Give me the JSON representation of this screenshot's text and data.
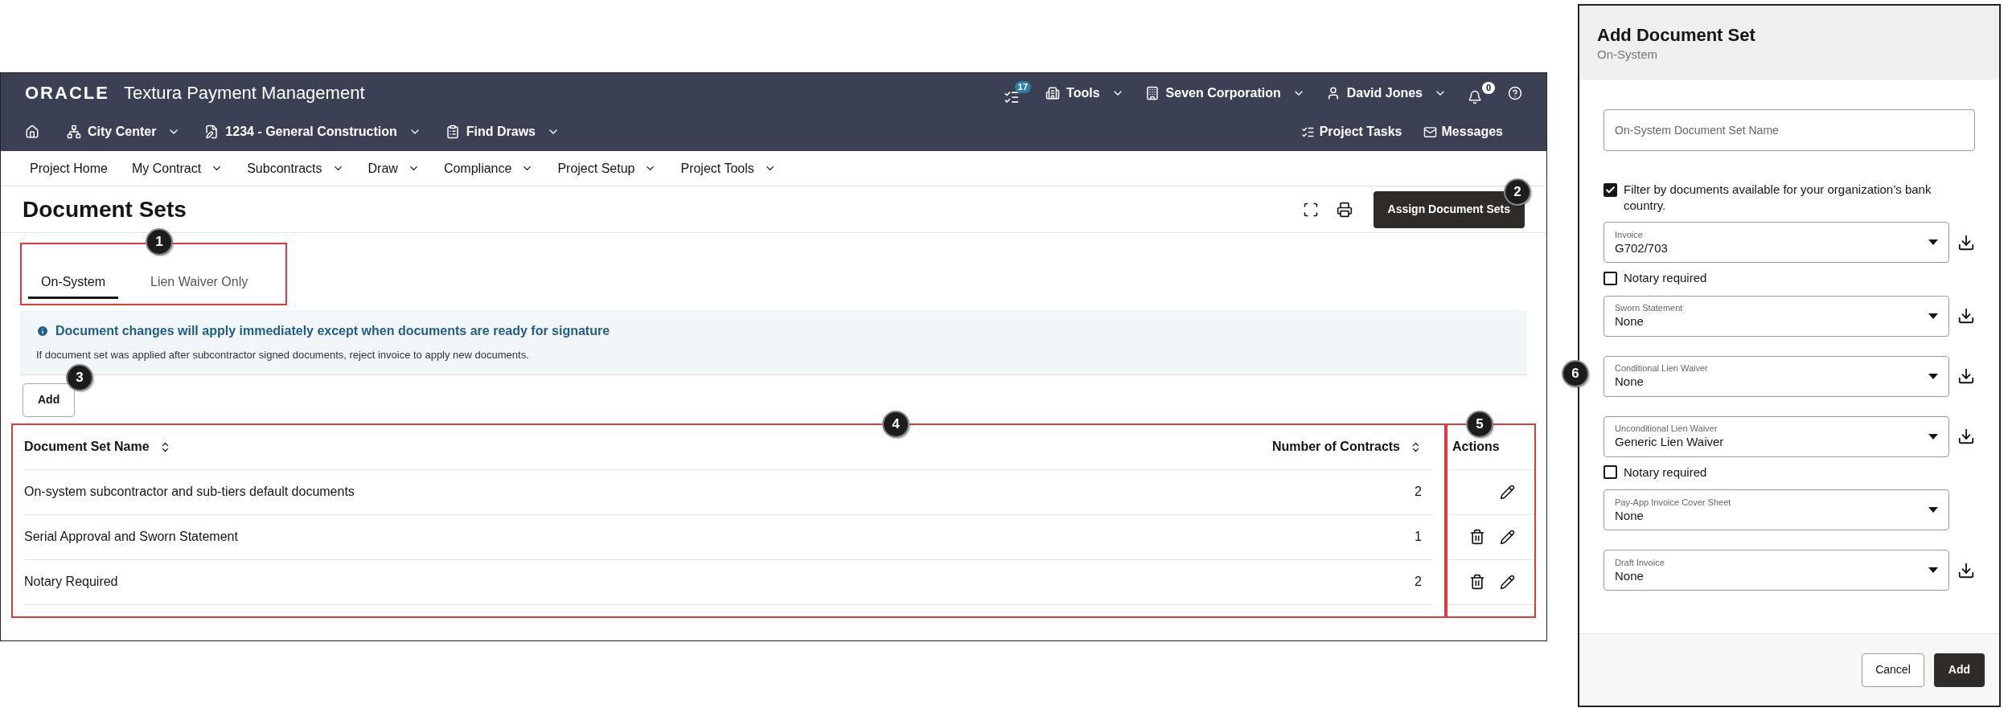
{
  "header": {
    "logo": "ORACLE",
    "product": "Textura Payment Management",
    "tasks_badge": "17",
    "menus": [
      {
        "label": "Tools"
      },
      {
        "label": "Seven Corporation"
      },
      {
        "label": "David Jones"
      }
    ],
    "notifications_badge": "0"
  },
  "context_bar": {
    "items": [
      {
        "label": "City Center"
      },
      {
        "label": "1234 - General Construction"
      },
      {
        "label": "Find Draws"
      }
    ],
    "links": [
      {
        "label": "Project Tasks"
      },
      {
        "label": "Messages"
      }
    ]
  },
  "nav": [
    {
      "label": "Project Home",
      "has_menu": false
    },
    {
      "label": "My Contract",
      "has_menu": true
    },
    {
      "label": "Subcontracts",
      "has_menu": true
    },
    {
      "label": "Draw",
      "has_menu": true
    },
    {
      "label": "Compliance",
      "has_menu": true
    },
    {
      "label": "Project Setup",
      "has_menu": true
    },
    {
      "label": "Project Tools",
      "has_menu": true
    }
  ],
  "page": {
    "title": "Document Sets",
    "primary_button": "Assign Document Sets",
    "primary_callout": "2"
  },
  "tabs": {
    "highlighted": true,
    "callout": "1",
    "items": [
      {
        "label": "On-System",
        "selected": true
      },
      {
        "label": "Lien Waiver Only",
        "selected": false
      }
    ]
  },
  "banner": {
    "title": "Document changes will apply immediately except when documents are ready for signature",
    "text": "If document set was applied after subcontractor signed documents, reject invoice to apply new documents."
  },
  "add_button": {
    "label": "Add",
    "callout": "3"
  },
  "table": {
    "highlighted": true,
    "callout": "4",
    "columns": [
      {
        "label": "Document Set Name",
        "sortable": true
      },
      {
        "label": "Number of Contracts",
        "sortable": true
      }
    ],
    "actions": {
      "label": "Actions",
      "highlighted": true,
      "callout": "5"
    },
    "rows": [
      {
        "name": "On-system subcontractor and sub-tiers default documents",
        "count": "2",
        "deletable": false
      },
      {
        "name": "Serial Approval and Sworn Statement",
        "count": "1",
        "deletable": true
      },
      {
        "name": "Notary Required",
        "count": "2",
        "deletable": true
      }
    ]
  },
  "panel": {
    "title": "Add Document Set",
    "subtitle": "On-System",
    "callout": "6",
    "name_field": {
      "placeholder": "On-System Document Set Name"
    },
    "filter": {
      "label": "Filter by documents available for your organization’s bank country.",
      "checked": true
    },
    "fields": [
      {
        "label": "Invoice",
        "value": "G702/703",
        "download": true,
        "notary": {
          "label": "Notary required",
          "checked": false
        }
      },
      {
        "label": "Sworn Statement",
        "value": "None",
        "download": true
      },
      {
        "label": "Conditional Lien Waiver",
        "value": "None",
        "download": true
      },
      {
        "label": "Unconditional Lien Waiver",
        "value": "Generic Lien Waiver",
        "download": true,
        "notary": {
          "label": "Notary required",
          "checked": false
        }
      },
      {
        "label": "Pay-App Invoice Cover Sheet",
        "value": "None",
        "download": false
      },
      {
        "label": "Draft Invoice",
        "value": "None",
        "download": true
      }
    ],
    "buttons": {
      "cancel": "Cancel",
      "submit": "Add"
    }
  }
}
